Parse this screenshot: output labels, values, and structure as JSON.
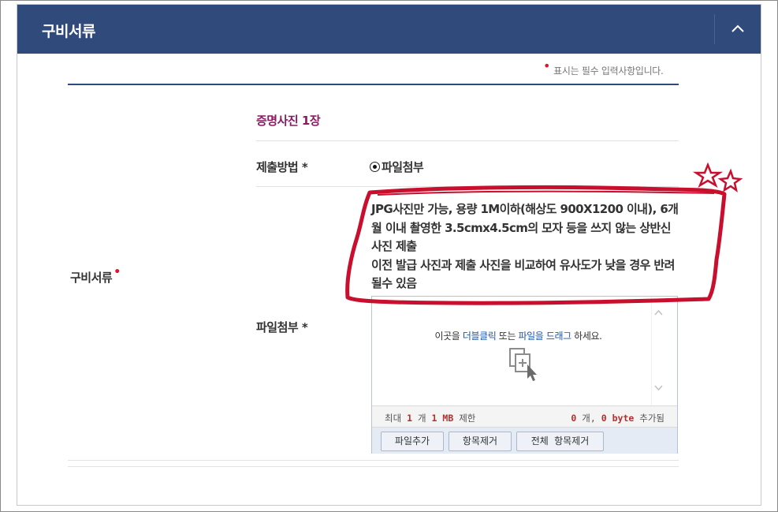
{
  "header": {
    "title": "구비서류",
    "collapse_icon": "chevron-up-icon"
  },
  "required_note": {
    "marker": "•",
    "text": "표시는 필수 입력사항입니다."
  },
  "row": {
    "label": "구비서류",
    "required_marker": "•"
  },
  "section": {
    "title": "증명사진 1장"
  },
  "submit_method": {
    "label": "제출방법 *",
    "option_label": "파일첨부",
    "selected": true
  },
  "notice": {
    "line1": "JPG사진만 가능, 용량 1M이하(해상도 900X1200 이내), 6개월 이내 촬영한 3.5cmx4.5cm의 모자 등을 쓰지 않는 상반신 사진 제출",
    "line2": "이전 발급 사진과 제출 사진을 비교하여 유사도가 낮을 경우 반려 될수 있음"
  },
  "file_attach": {
    "label": "파일첨부 *",
    "drop_text_prefix": "이곳을 ",
    "drop_text_link1": "더블클릭",
    "drop_text_middle": " 또는 ",
    "drop_text_link2": "파일을 드래그",
    "drop_text_suffix": " 하세요.",
    "drop_icon": "file-add-icon",
    "status": {
      "max_prefix": "최대",
      "max_count": "1",
      "count_unit": "개",
      "max_size": "1",
      "size_unit": "MB",
      "limit_suffix": "제한",
      "added_count": "0",
      "added_count_unit": "개,",
      "added_bytes": "0",
      "bytes_unit": "byte",
      "added_suffix": "추가됨"
    },
    "buttons": {
      "add": "파일추가",
      "remove": "항목제거",
      "remove_all": "전체 항목제거"
    }
  },
  "colors": {
    "header_bg": "#2f4a7b",
    "section_title": "#8b1a63",
    "required_dot": "#e0142d",
    "annotation_red": "#c8102e",
    "link": "#2058a8"
  }
}
